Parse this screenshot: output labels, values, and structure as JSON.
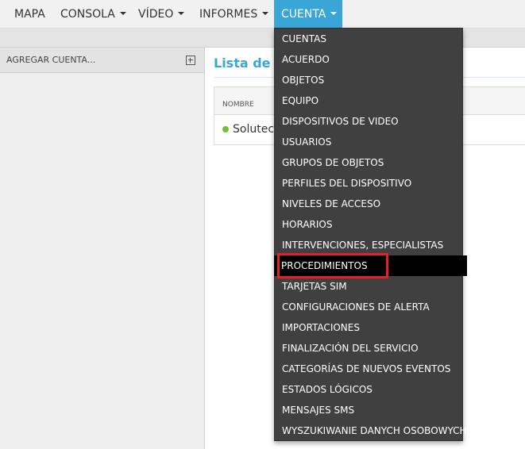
{
  "nav": {
    "items": [
      {
        "label": "MAPA",
        "has_caret": false
      },
      {
        "label": "CONSOLA",
        "has_caret": true
      },
      {
        "label": "VÍDEO",
        "has_caret": true
      },
      {
        "label": "INFORMES",
        "has_caret": true
      },
      {
        "label": "CUENTA",
        "has_caret": true,
        "active": true
      }
    ]
  },
  "sidebar": {
    "title": "AGREGAR CUENTA...",
    "add_icon": "plus-square-icon"
  },
  "main": {
    "title": "Lista de c",
    "columns": [
      "NOMBRE"
    ],
    "rows": [
      {
        "name": "Solutec",
        "status_color": "#6fbf3a"
      }
    ]
  },
  "dropdown": {
    "items": [
      "CUENTAS",
      "ACUERDO",
      "OBJETOS",
      "EQUIPO",
      "DISPOSITIVOS DE VIDEO",
      "USUARIOS",
      "GRUPOS DE OBJETOS",
      "PERFILES DEL DISPOSITIVO",
      "NIVELES DE ACCESO",
      "HORARIOS",
      "INTERVENCIONES, ESPECIALISTAS",
      "PROCEDIMIENTOS",
      "TARJETAS SIM",
      "CONFIGURACIONES DE ALERTA",
      "IMPORTACIONES",
      "FINALIZACIÓN DEL SERVICIO",
      "CATEGORÍAS DE NUEVOS EVENTOS",
      "ESTADOS LÓGICOS",
      "MENSAJES SMS",
      "WYSZUKIWANIE DANYCH OSOBOWYCH"
    ],
    "hovered": "PROCEDIMIENTOS"
  },
  "colors": {
    "accent": "#3aa6d8",
    "menu_bg": "#404040",
    "hover_bg": "#000000",
    "highlight": "#e0202a"
  }
}
